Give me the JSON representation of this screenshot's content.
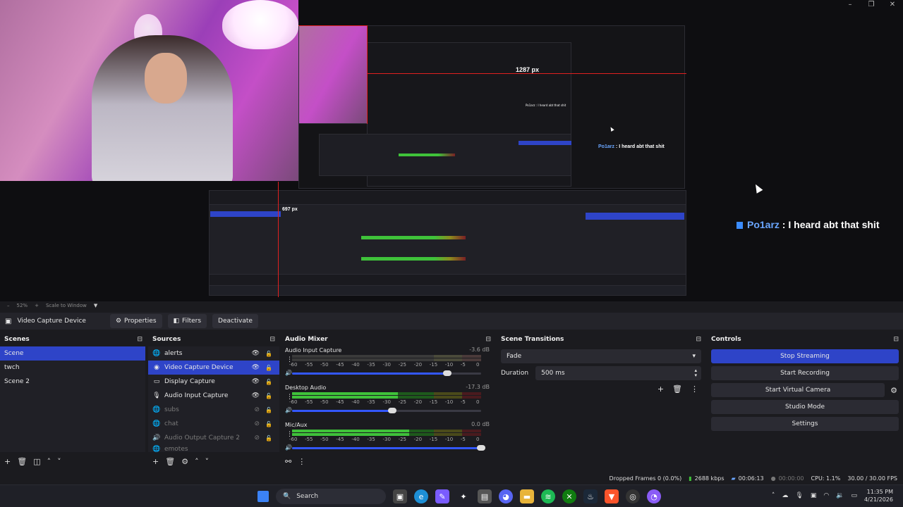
{
  "preview": {
    "measure_label": "1287 px",
    "measure_label_small": "697 px",
    "chat": {
      "user": "Po1arz",
      "message": " : I heard abt that shit"
    }
  },
  "zoombar": {
    "zoom": "52%",
    "mode": "Scale to Window"
  },
  "context": {
    "source_name": "Video Capture Device",
    "properties": "Properties",
    "filters": "Filters",
    "deactivate": "Deactivate"
  },
  "scenes": {
    "title": "Scenes",
    "items": [
      "Scene",
      "twch",
      "Scene 2"
    ]
  },
  "sources": {
    "title": "Sources",
    "items": [
      "alerts",
      "Video Capture Device",
      "Display Capture",
      "Audio Input Capture",
      "subs",
      "chat",
      "Audio Output Capture 2",
      "emotes"
    ]
  },
  "mixer": {
    "title": "Audio Mixer",
    "channels": [
      {
        "name": "Audio Input Capture",
        "db": "-3.6 dB",
        "level": 0.0,
        "volume": 0.82
      },
      {
        "name": "Desktop Audio",
        "db": "-17.3 dB",
        "level": 0.56,
        "volume": 0.53
      },
      {
        "name": "Mic/Aux",
        "db": "0.0 dB",
        "level": 0.62,
        "volume": 1.0
      }
    ],
    "ticks": [
      "-60",
      "-55",
      "-50",
      "-45",
      "-40",
      "-35",
      "-30",
      "-25",
      "-20",
      "-15",
      "-10",
      "-5",
      "0"
    ]
  },
  "transitions": {
    "title": "Scene Transitions",
    "selected": "Fade",
    "duration_label": "Duration",
    "duration_value": "500 ms"
  },
  "controls": {
    "title": "Controls",
    "stop_streaming": "Stop Streaming",
    "start_recording": "Start Recording",
    "start_virtual_camera": "Start Virtual Camera",
    "studio_mode": "Studio Mode",
    "settings": "Settings"
  },
  "status": {
    "dropped": "Dropped Frames 0 (0.0%)",
    "bitrate": "2688 kbps",
    "stream_time": "00:06:13",
    "rec_time": "00:00:00",
    "cpu": "CPU: 1.1%",
    "fps": "30.00 / 30.00 FPS"
  },
  "taskbar": {
    "search": "Search",
    "time": "11:35 PM",
    "date": "4/21/2026"
  },
  "colors": {
    "accent": "#2e44c8",
    "meter_green": "#3fc23a",
    "meter_yellow": "#8c8c1e",
    "meter_red": "#7a1f24"
  }
}
